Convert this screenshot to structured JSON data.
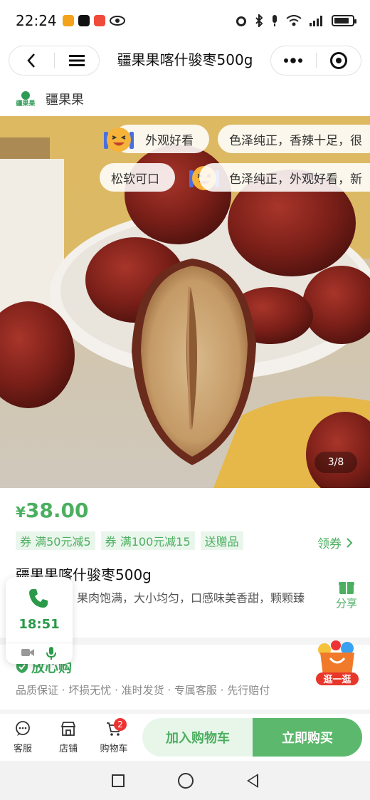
{
  "status_bar": {
    "time": "22:24",
    "app_icons": [
      {
        "name": "app-icon-1",
        "color": "#f3a21a"
      },
      {
        "name": "douyin-icon",
        "color": "#111111"
      },
      {
        "name": "app-icon-3",
        "color": "#f04a3a"
      }
    ],
    "battery_level": 0.85
  },
  "nav": {
    "title": "疆果果喀什骏枣500g"
  },
  "shop": {
    "logo_text": "疆果果",
    "name": "疆果果"
  },
  "gallery": {
    "reviews": [
      "外观好看",
      "色泽纯正，香辣十足，很",
      "松软可口",
      "色泽纯正，外观好看，新"
    ],
    "counter": "3/8"
  },
  "product": {
    "currency": "¥",
    "price": "38.00",
    "coupons": [
      "券 满50元减5",
      "券 满100元减15",
      "送赠品"
    ],
    "get_coupon_label": "领券",
    "title": "疆果果喀什骏枣500g",
    "description": "果肉饱满，大小均匀，口感味美香甜，颗颗臻",
    "share_label": "分享"
  },
  "call_widget": {
    "time": "18:51"
  },
  "assurance": {
    "title": "放心购",
    "items": "品质保证 · 坏损无忧 · 准时发货 · 专属客服 · 先行赔付"
  },
  "browse_badge": {
    "label": "逛一逛"
  },
  "bottom_bar": {
    "customer_service": "客服",
    "store": "店铺",
    "cart": "购物车",
    "cart_count": "2",
    "add_to_cart": "加入购物车",
    "buy_now": "立即购买"
  },
  "colors": {
    "brand_green": "#4caf60",
    "badge_red": "#e33333"
  }
}
